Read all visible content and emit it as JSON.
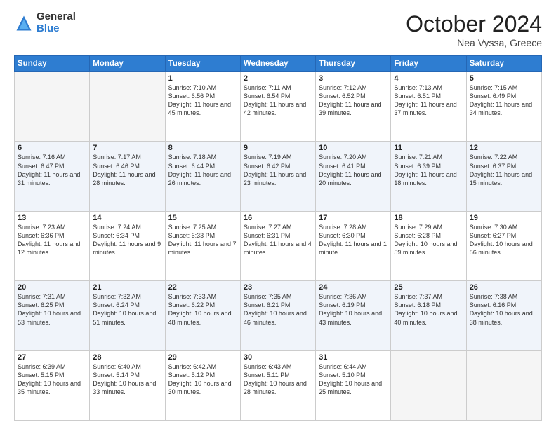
{
  "header": {
    "logo_general": "General",
    "logo_blue": "Blue",
    "month_title": "October 2024",
    "location": "Nea Vyssa, Greece"
  },
  "weekdays": [
    "Sunday",
    "Monday",
    "Tuesday",
    "Wednesday",
    "Thursday",
    "Friday",
    "Saturday"
  ],
  "weeks": [
    [
      {
        "day": "",
        "info": ""
      },
      {
        "day": "",
        "info": ""
      },
      {
        "day": "1",
        "info": "Sunrise: 7:10 AM\nSunset: 6:56 PM\nDaylight: 11 hours and 45 minutes."
      },
      {
        "day": "2",
        "info": "Sunrise: 7:11 AM\nSunset: 6:54 PM\nDaylight: 11 hours and 42 minutes."
      },
      {
        "day": "3",
        "info": "Sunrise: 7:12 AM\nSunset: 6:52 PM\nDaylight: 11 hours and 39 minutes."
      },
      {
        "day": "4",
        "info": "Sunrise: 7:13 AM\nSunset: 6:51 PM\nDaylight: 11 hours and 37 minutes."
      },
      {
        "day": "5",
        "info": "Sunrise: 7:15 AM\nSunset: 6:49 PM\nDaylight: 11 hours and 34 minutes."
      }
    ],
    [
      {
        "day": "6",
        "info": "Sunrise: 7:16 AM\nSunset: 6:47 PM\nDaylight: 11 hours and 31 minutes."
      },
      {
        "day": "7",
        "info": "Sunrise: 7:17 AM\nSunset: 6:46 PM\nDaylight: 11 hours and 28 minutes."
      },
      {
        "day": "8",
        "info": "Sunrise: 7:18 AM\nSunset: 6:44 PM\nDaylight: 11 hours and 26 minutes."
      },
      {
        "day": "9",
        "info": "Sunrise: 7:19 AM\nSunset: 6:42 PM\nDaylight: 11 hours and 23 minutes."
      },
      {
        "day": "10",
        "info": "Sunrise: 7:20 AM\nSunset: 6:41 PM\nDaylight: 11 hours and 20 minutes."
      },
      {
        "day": "11",
        "info": "Sunrise: 7:21 AM\nSunset: 6:39 PM\nDaylight: 11 hours and 18 minutes."
      },
      {
        "day": "12",
        "info": "Sunrise: 7:22 AM\nSunset: 6:37 PM\nDaylight: 11 hours and 15 minutes."
      }
    ],
    [
      {
        "day": "13",
        "info": "Sunrise: 7:23 AM\nSunset: 6:36 PM\nDaylight: 11 hours and 12 minutes."
      },
      {
        "day": "14",
        "info": "Sunrise: 7:24 AM\nSunset: 6:34 PM\nDaylight: 11 hours and 9 minutes."
      },
      {
        "day": "15",
        "info": "Sunrise: 7:25 AM\nSunset: 6:33 PM\nDaylight: 11 hours and 7 minutes."
      },
      {
        "day": "16",
        "info": "Sunrise: 7:27 AM\nSunset: 6:31 PM\nDaylight: 11 hours and 4 minutes."
      },
      {
        "day": "17",
        "info": "Sunrise: 7:28 AM\nSunset: 6:30 PM\nDaylight: 11 hours and 1 minute."
      },
      {
        "day": "18",
        "info": "Sunrise: 7:29 AM\nSunset: 6:28 PM\nDaylight: 10 hours and 59 minutes."
      },
      {
        "day": "19",
        "info": "Sunrise: 7:30 AM\nSunset: 6:27 PM\nDaylight: 10 hours and 56 minutes."
      }
    ],
    [
      {
        "day": "20",
        "info": "Sunrise: 7:31 AM\nSunset: 6:25 PM\nDaylight: 10 hours and 53 minutes."
      },
      {
        "day": "21",
        "info": "Sunrise: 7:32 AM\nSunset: 6:24 PM\nDaylight: 10 hours and 51 minutes."
      },
      {
        "day": "22",
        "info": "Sunrise: 7:33 AM\nSunset: 6:22 PM\nDaylight: 10 hours and 48 minutes."
      },
      {
        "day": "23",
        "info": "Sunrise: 7:35 AM\nSunset: 6:21 PM\nDaylight: 10 hours and 46 minutes."
      },
      {
        "day": "24",
        "info": "Sunrise: 7:36 AM\nSunset: 6:19 PM\nDaylight: 10 hours and 43 minutes."
      },
      {
        "day": "25",
        "info": "Sunrise: 7:37 AM\nSunset: 6:18 PM\nDaylight: 10 hours and 40 minutes."
      },
      {
        "day": "26",
        "info": "Sunrise: 7:38 AM\nSunset: 6:16 PM\nDaylight: 10 hours and 38 minutes."
      }
    ],
    [
      {
        "day": "27",
        "info": "Sunrise: 6:39 AM\nSunset: 5:15 PM\nDaylight: 10 hours and 35 minutes."
      },
      {
        "day": "28",
        "info": "Sunrise: 6:40 AM\nSunset: 5:14 PM\nDaylight: 10 hours and 33 minutes."
      },
      {
        "day": "29",
        "info": "Sunrise: 6:42 AM\nSunset: 5:12 PM\nDaylight: 10 hours and 30 minutes."
      },
      {
        "day": "30",
        "info": "Sunrise: 6:43 AM\nSunset: 5:11 PM\nDaylight: 10 hours and 28 minutes."
      },
      {
        "day": "31",
        "info": "Sunrise: 6:44 AM\nSunset: 5:10 PM\nDaylight: 10 hours and 25 minutes."
      },
      {
        "day": "",
        "info": ""
      },
      {
        "day": "",
        "info": ""
      }
    ]
  ]
}
